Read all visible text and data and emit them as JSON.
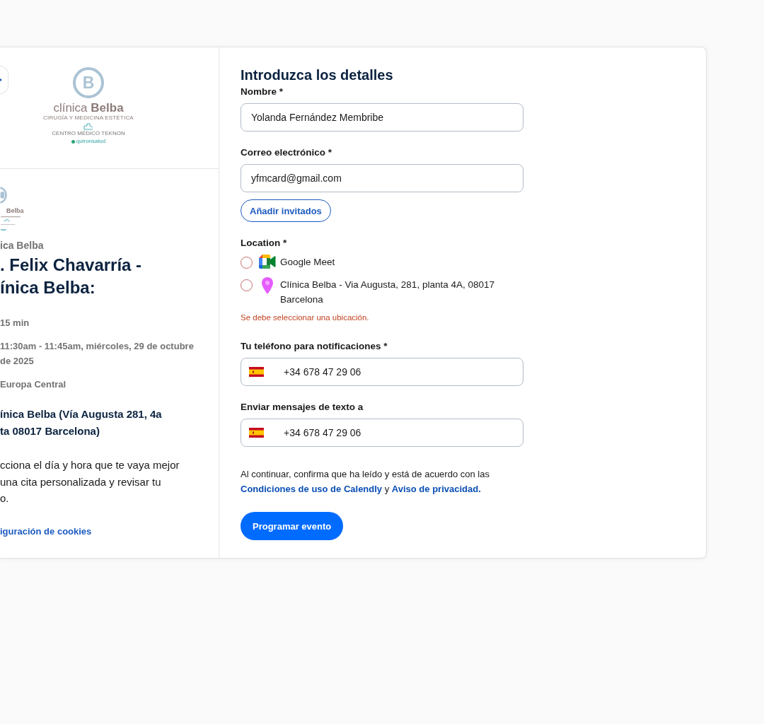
{
  "sidebar": {
    "logo": {
      "mark": "B",
      "name": "clínica **Belba**",
      "tagline": "CIRUGÍA Y MEDICINA ESTÉTICA",
      "center": "CENTRO MÉDICO TEKNON",
      "group": "quironsalud"
    },
    "small_logo": {
      "name": "Belba"
    },
    "organizer": "ica Belba",
    "title": ". Felix Chavarría -\nínica Belba:",
    "details": [
      {
        "text": "15 min"
      },
      {
        "text": "11:30am - 11:45am, miércoles, 29 de octubre\nde 2025"
      },
      {
        "text": "Europa Central"
      }
    ],
    "location": "ínica Belba (Vía Augusta 281, 4a\nta 08017 Barcelona)",
    "description": "cciona el día y hora que te vaya mejor\nuna cita personalizada y revisar tu\no.",
    "cookie_link": "iguración de cookies"
  },
  "form": {
    "title": "Introduzca los detalles",
    "fields": [
      {
        "kind": "text",
        "label": "Nombre *",
        "value": "Yolanda Fernández Membribe"
      },
      {
        "kind": "text",
        "label": "Correo electrónico *",
        "value": "yfmcard@gmail.com"
      },
      {
        "kind": "button",
        "label": "Añadir invitados"
      },
      {
        "kind": "radio",
        "label": "Location *",
        "options": [
          {
            "kind": "video",
            "label": "Google Meet",
            "selected": false
          },
          {
            "kind": "pin",
            "label": "Clínica Belba - Via Augusta, 281, planta 4A, 08017 Barcelona",
            "selected": false
          }
        ],
        "error": "Se debe seleccionar una ubicación."
      },
      {
        "kind": "phone",
        "label": "Tu teléfono para notificaciones *",
        "value": "+34 678 47 29 06"
      },
      {
        "kind": "phone",
        "label": "Enviar mensajes de texto a",
        "value": "+34 678 47 29 06"
      }
    ],
    "consent": {
      "text": "Al continuar, confirma que ha leído y está de acuerdo con las",
      "links": [
        "Condiciones de uso de Calendly",
        "Aviso de privacidad."
      ],
      "joiner": "y"
    },
    "submit": "Programar evento"
  }
}
